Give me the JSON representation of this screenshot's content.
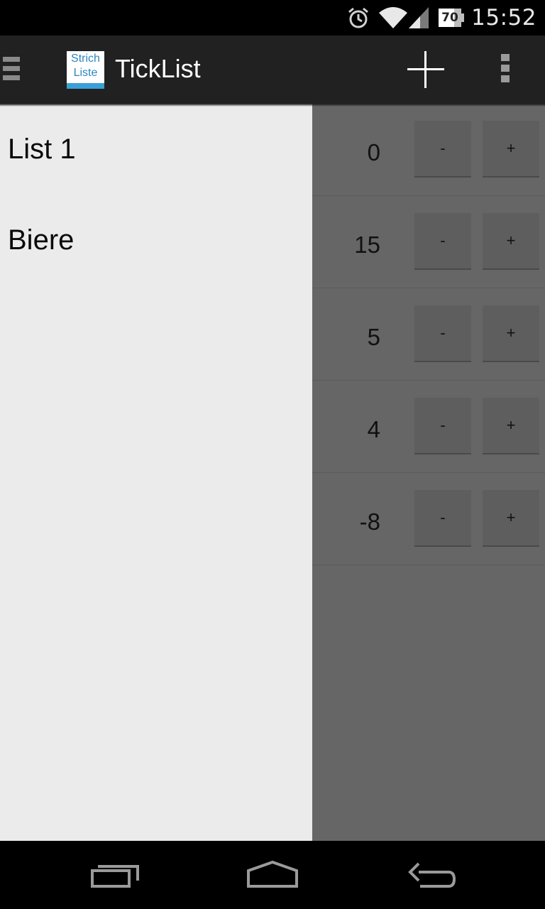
{
  "status_bar": {
    "time": "15:52",
    "battery_level": "70",
    "icons": [
      "alarm-icon",
      "wifi-icon",
      "signal-icon",
      "battery-icon"
    ]
  },
  "action_bar": {
    "title": "TickList",
    "logo_line1": "Strich",
    "logo_line2": "Liste",
    "actions": [
      "add-icon",
      "overflow-menu-icon"
    ]
  },
  "drawer": {
    "items": [
      {
        "label": "List 1"
      },
      {
        "label": "Biere"
      }
    ]
  },
  "counters": [
    {
      "value": "0",
      "minus": "-",
      "plus": "+"
    },
    {
      "value": "15",
      "minus": "-",
      "plus": "+"
    },
    {
      "value": "5",
      "minus": "-",
      "plus": "+"
    },
    {
      "value": "4",
      "minus": "-",
      "plus": "+"
    },
    {
      "value": "-8",
      "minus": "-",
      "plus": "+"
    }
  ],
  "nav_bar": {
    "icons": [
      "recent-apps-icon",
      "home-icon",
      "back-icon"
    ]
  },
  "colors": {
    "action_bar": "#212121",
    "drawer_bg": "#ebebeb",
    "content_bg": "#666666",
    "logo_accent": "#3aa0d8"
  }
}
